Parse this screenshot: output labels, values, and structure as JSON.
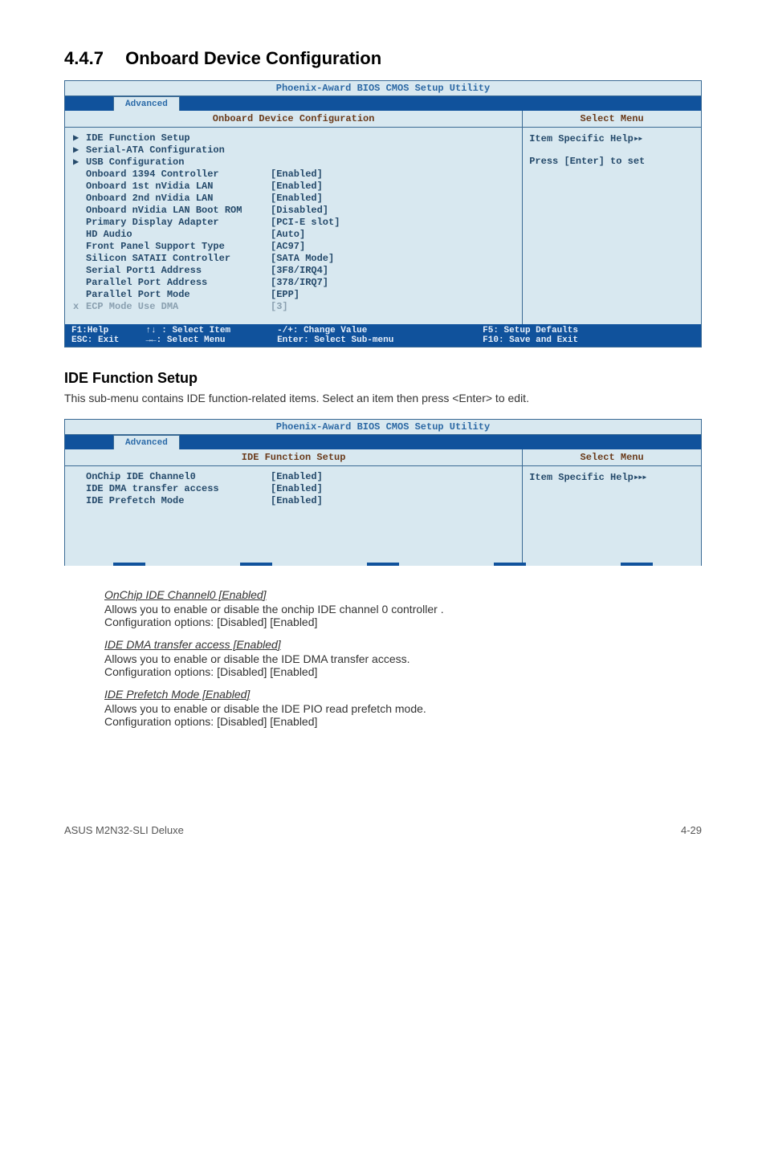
{
  "section": {
    "number": "4.4.7",
    "title": "Onboard Device Configuration"
  },
  "bios1": {
    "util_title": "Phoenix-Award BIOS CMOS Setup Utility",
    "tab": "Advanced",
    "panel_title": "Onboard Device Configuration",
    "select_menu": "Select Menu",
    "help_line1": "Item Specific Help",
    "help_line2": "Press [Enter] to set",
    "rows": [
      {
        "marker": "▶",
        "label": "IDE Function Setup",
        "value": "",
        "dim": false
      },
      {
        "marker": "▶",
        "label": "Serial-ATA Configuration",
        "value": "",
        "dim": false
      },
      {
        "marker": "▶",
        "label": "USB Configuration",
        "value": "",
        "dim": false
      },
      {
        "marker": "",
        "label": "Onboard 1394 Controller",
        "value": "[Enabled]",
        "dim": false
      },
      {
        "marker": "",
        "label": "Onboard 1st nVidia LAN",
        "value": "[Enabled]",
        "dim": false
      },
      {
        "marker": "",
        "label": "Onboard 2nd nVidia LAN",
        "value": "[Enabled]",
        "dim": false
      },
      {
        "marker": "",
        "label": "Onboard nVidia LAN Boot ROM",
        "value": "[Disabled]",
        "dim": false
      },
      {
        "marker": "",
        "label": "Primary Display Adapter",
        "value": "[PCI-E slot]",
        "dim": false
      },
      {
        "marker": "",
        "label": "HD Audio",
        "value": "[Auto]",
        "dim": false
      },
      {
        "marker": "",
        "label": "Front Panel Support Type",
        "value": "[AC97]",
        "dim": false
      },
      {
        "marker": "",
        "label": "Silicon SATAII Controller",
        "value": "[SATA Mode]",
        "dim": false
      },
      {
        "marker": "",
        "label": "Serial Port1 Address",
        "value": "[3F8/IRQ4]",
        "dim": false
      },
      {
        "marker": "",
        "label": "Parallel Port Address",
        "value": "[378/IRQ7]",
        "dim": false
      },
      {
        "marker": "",
        "label": "Parallel Port Mode",
        "value": "[EPP]",
        "dim": false
      },
      {
        "marker": "x",
        "label": "ECP Mode Use DMA",
        "value": "[3]",
        "dim": true
      }
    ],
    "keys": {
      "k1": "F1:Help",
      "k2": "↑↓ : Select Item",
      "k3": "-/+: Change Value",
      "k4": "F5: Setup Defaults",
      "k5": "ESC: Exit",
      "k6": "→←: Select Menu",
      "k7": "Enter: Select Sub-menu",
      "k8": "F10: Save and Exit"
    }
  },
  "ide_section": {
    "heading": "IDE Function Setup",
    "desc": "This sub-menu contains IDE function-related items. Select an item then press <Enter> to edit."
  },
  "bios2": {
    "util_title": "Phoenix-Award BIOS CMOS Setup Utility",
    "tab": "Advanced",
    "panel_title": "IDE Function Setup",
    "select_menu": "Select Menu",
    "help_line1": "Item Specific Help",
    "rows": [
      {
        "marker": "",
        "label": "OnChip IDE Channel0",
        "value": "[Enabled]",
        "dim": false
      },
      {
        "marker": "",
        "label": "IDE DMA transfer access",
        "value": "[Enabled]",
        "dim": false
      },
      {
        "marker": "",
        "label": "IDE Prefetch Mode",
        "value": "[Enabled]",
        "dim": false
      }
    ]
  },
  "options": [
    {
      "title": "OnChip IDE Channel0 [Enabled]",
      "l1": "Allows you to enable or disable the onchip IDE channel 0 controller .",
      "l2": "Configuration options: [Disabled] [Enabled]"
    },
    {
      "title": "IDE DMA transfer access [Enabled]",
      "l1": "Allows you to enable or disable the IDE DMA transfer access.",
      "l2": "Configuration options: [Disabled] [Enabled]"
    },
    {
      "title": "IDE Prefetch Mode [Enabled]",
      "l1": "Allows you to enable or disable the IDE PIO read prefetch mode.",
      "l2": "Configuration options: [Disabled] [Enabled]"
    }
  ],
  "footer": {
    "left": "ASUS M2N32-SLI Deluxe",
    "right": "4-29"
  }
}
